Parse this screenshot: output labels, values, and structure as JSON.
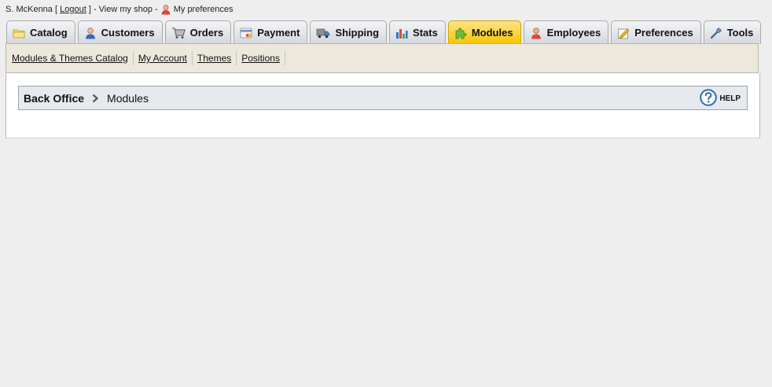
{
  "userbar": {
    "user_name": "S. McKenna [",
    "logout_label": "Logout",
    "sep1": "] - View my shop -",
    "prefs_label": "My preferences"
  },
  "tabs": [
    {
      "label": "Catalog",
      "icon": "folder-icon",
      "active": false
    },
    {
      "label": "Customers",
      "icon": "customer-icon",
      "active": false
    },
    {
      "label": "Orders",
      "icon": "cart-icon",
      "active": false
    },
    {
      "label": "Payment",
      "icon": "payment-icon",
      "active": false
    },
    {
      "label": "Shipping",
      "icon": "truck-icon",
      "active": false
    },
    {
      "label": "Stats",
      "icon": "chart-icon",
      "active": false
    },
    {
      "label": "Modules",
      "icon": "puzzle-icon",
      "active": true
    },
    {
      "label": "Employees",
      "icon": "employee-icon",
      "active": false
    },
    {
      "label": "Preferences",
      "icon": "preferences-icon",
      "active": false
    },
    {
      "label": "Tools",
      "icon": "wrench-icon",
      "active": false
    }
  ],
  "subnav": {
    "items": [
      "Modules & Themes Catalog",
      "My Account",
      "Themes",
      "Positions"
    ]
  },
  "breadcrumb": {
    "home": "Back Office",
    "current": "Modules"
  },
  "help": {
    "label": "HELP"
  },
  "colors": {
    "active_tab": "#f6c500",
    "subnav_bg": "#ece8db",
    "crumb_bg": "#e6e9ee",
    "help_icon": "#2f6fb1"
  }
}
